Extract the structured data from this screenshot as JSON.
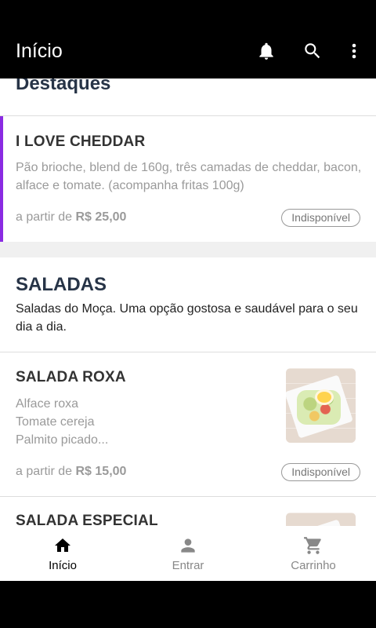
{
  "appbar": {
    "title": "Início",
    "icons": [
      "bell-icon",
      "search-icon",
      "more-vert-icon"
    ]
  },
  "highlights": {
    "title": "Destaques",
    "item": {
      "name": "I LOVE CHEDDAR",
      "description": "Pão brioche, blend de 160g, três camadas de cheddar, bacon, alface e tomate. (acompanha fritas 100g)",
      "price_prefix": "a partir de",
      "price": "R$ 25,00",
      "status": "Indisponível"
    }
  },
  "category": {
    "title": "SALADAS",
    "description": "Saladas do Moça. Uma opção gostosa e saudável para o seu dia a dia."
  },
  "items": [
    {
      "name": "SALADA ROXA",
      "description_lines": [
        "Alface roxa",
        "Tomate cereja",
        "Palmito picado..."
      ],
      "price_prefix": "a partir de",
      "price": "R$ 15,00",
      "status": "Indisponível"
    },
    {
      "name": "SALADA ESPECIAL"
    }
  ],
  "bottom_nav": [
    {
      "label": "Início",
      "icon": "home-icon",
      "active": true
    },
    {
      "label": "Entrar",
      "icon": "person-icon",
      "active": false
    },
    {
      "label": "Carrinho",
      "icon": "cart-icon",
      "active": false
    }
  ],
  "colors": {
    "accent": "#8a2be2",
    "title": "#273447"
  }
}
